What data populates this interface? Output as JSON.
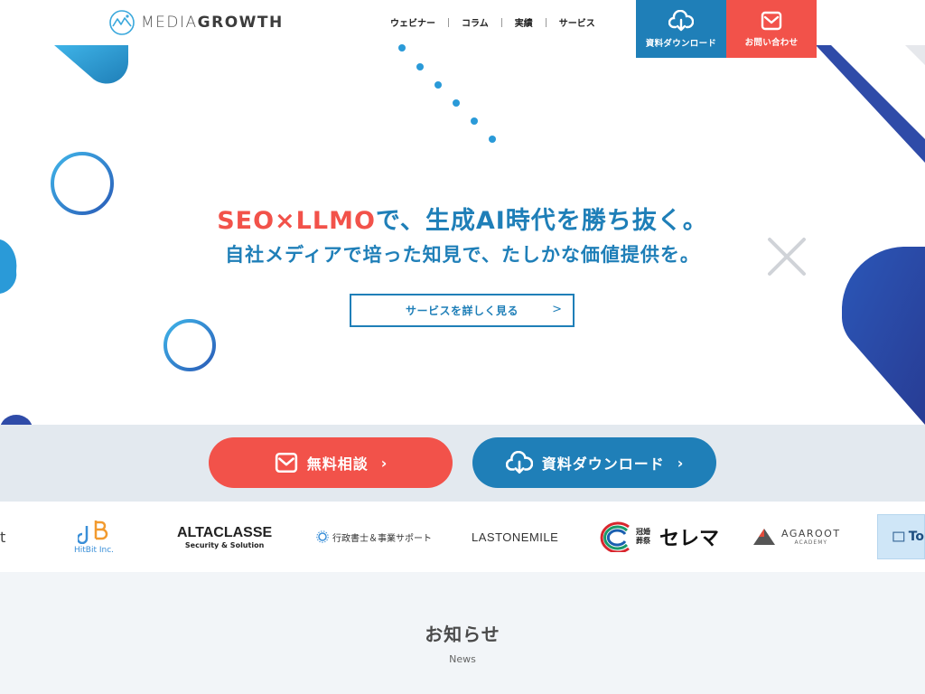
{
  "header": {
    "logo_light": "MEDIA",
    "logo_bold": "GROWTH",
    "nav": [
      "ウェビナー",
      "コラム",
      "実績",
      "サービス"
    ],
    "download_label": "資料ダウンロード",
    "contact_label": "お問い合わせ"
  },
  "hero": {
    "title_accent": "SEO×LLMO",
    "title_rest": "で、生成AI時代を勝ち抜く。",
    "subtitle": "自社メディアで培った知見で、たしかな価値提供を。",
    "cta_label": "サービスを詳しく見る",
    "cta_arrow": ">"
  },
  "cta_band": {
    "consult_label": "無料相談",
    "download_label": "資料ダウンロード",
    "chevron": "›"
  },
  "client_logos": [
    {
      "name": "partial-t",
      "text": "t"
    },
    {
      "name": "hitbit",
      "text": "HitBit Inc."
    },
    {
      "name": "altaclasse",
      "text": "ALTACLASSE",
      "sub": "Security & Solution"
    },
    {
      "name": "gyousei",
      "text": "行政書士＆事業サポート"
    },
    {
      "name": "lastonemile",
      "text": "LASTONEMILE"
    },
    {
      "name": "selema",
      "text": "セレマ",
      "small": "冠婚葬祭"
    },
    {
      "name": "agaroot",
      "text": "AGAROOT",
      "sub": "ACADEMY"
    },
    {
      "name": "partial-to",
      "text": "To"
    }
  ],
  "news": {
    "title": "お知らせ",
    "subtitle": "News"
  },
  "colors": {
    "brand_blue": "#1f7fb8",
    "brand_red": "#f2524a",
    "navy": "#2f4ba8",
    "band_bg": "#e3e9ef"
  }
}
